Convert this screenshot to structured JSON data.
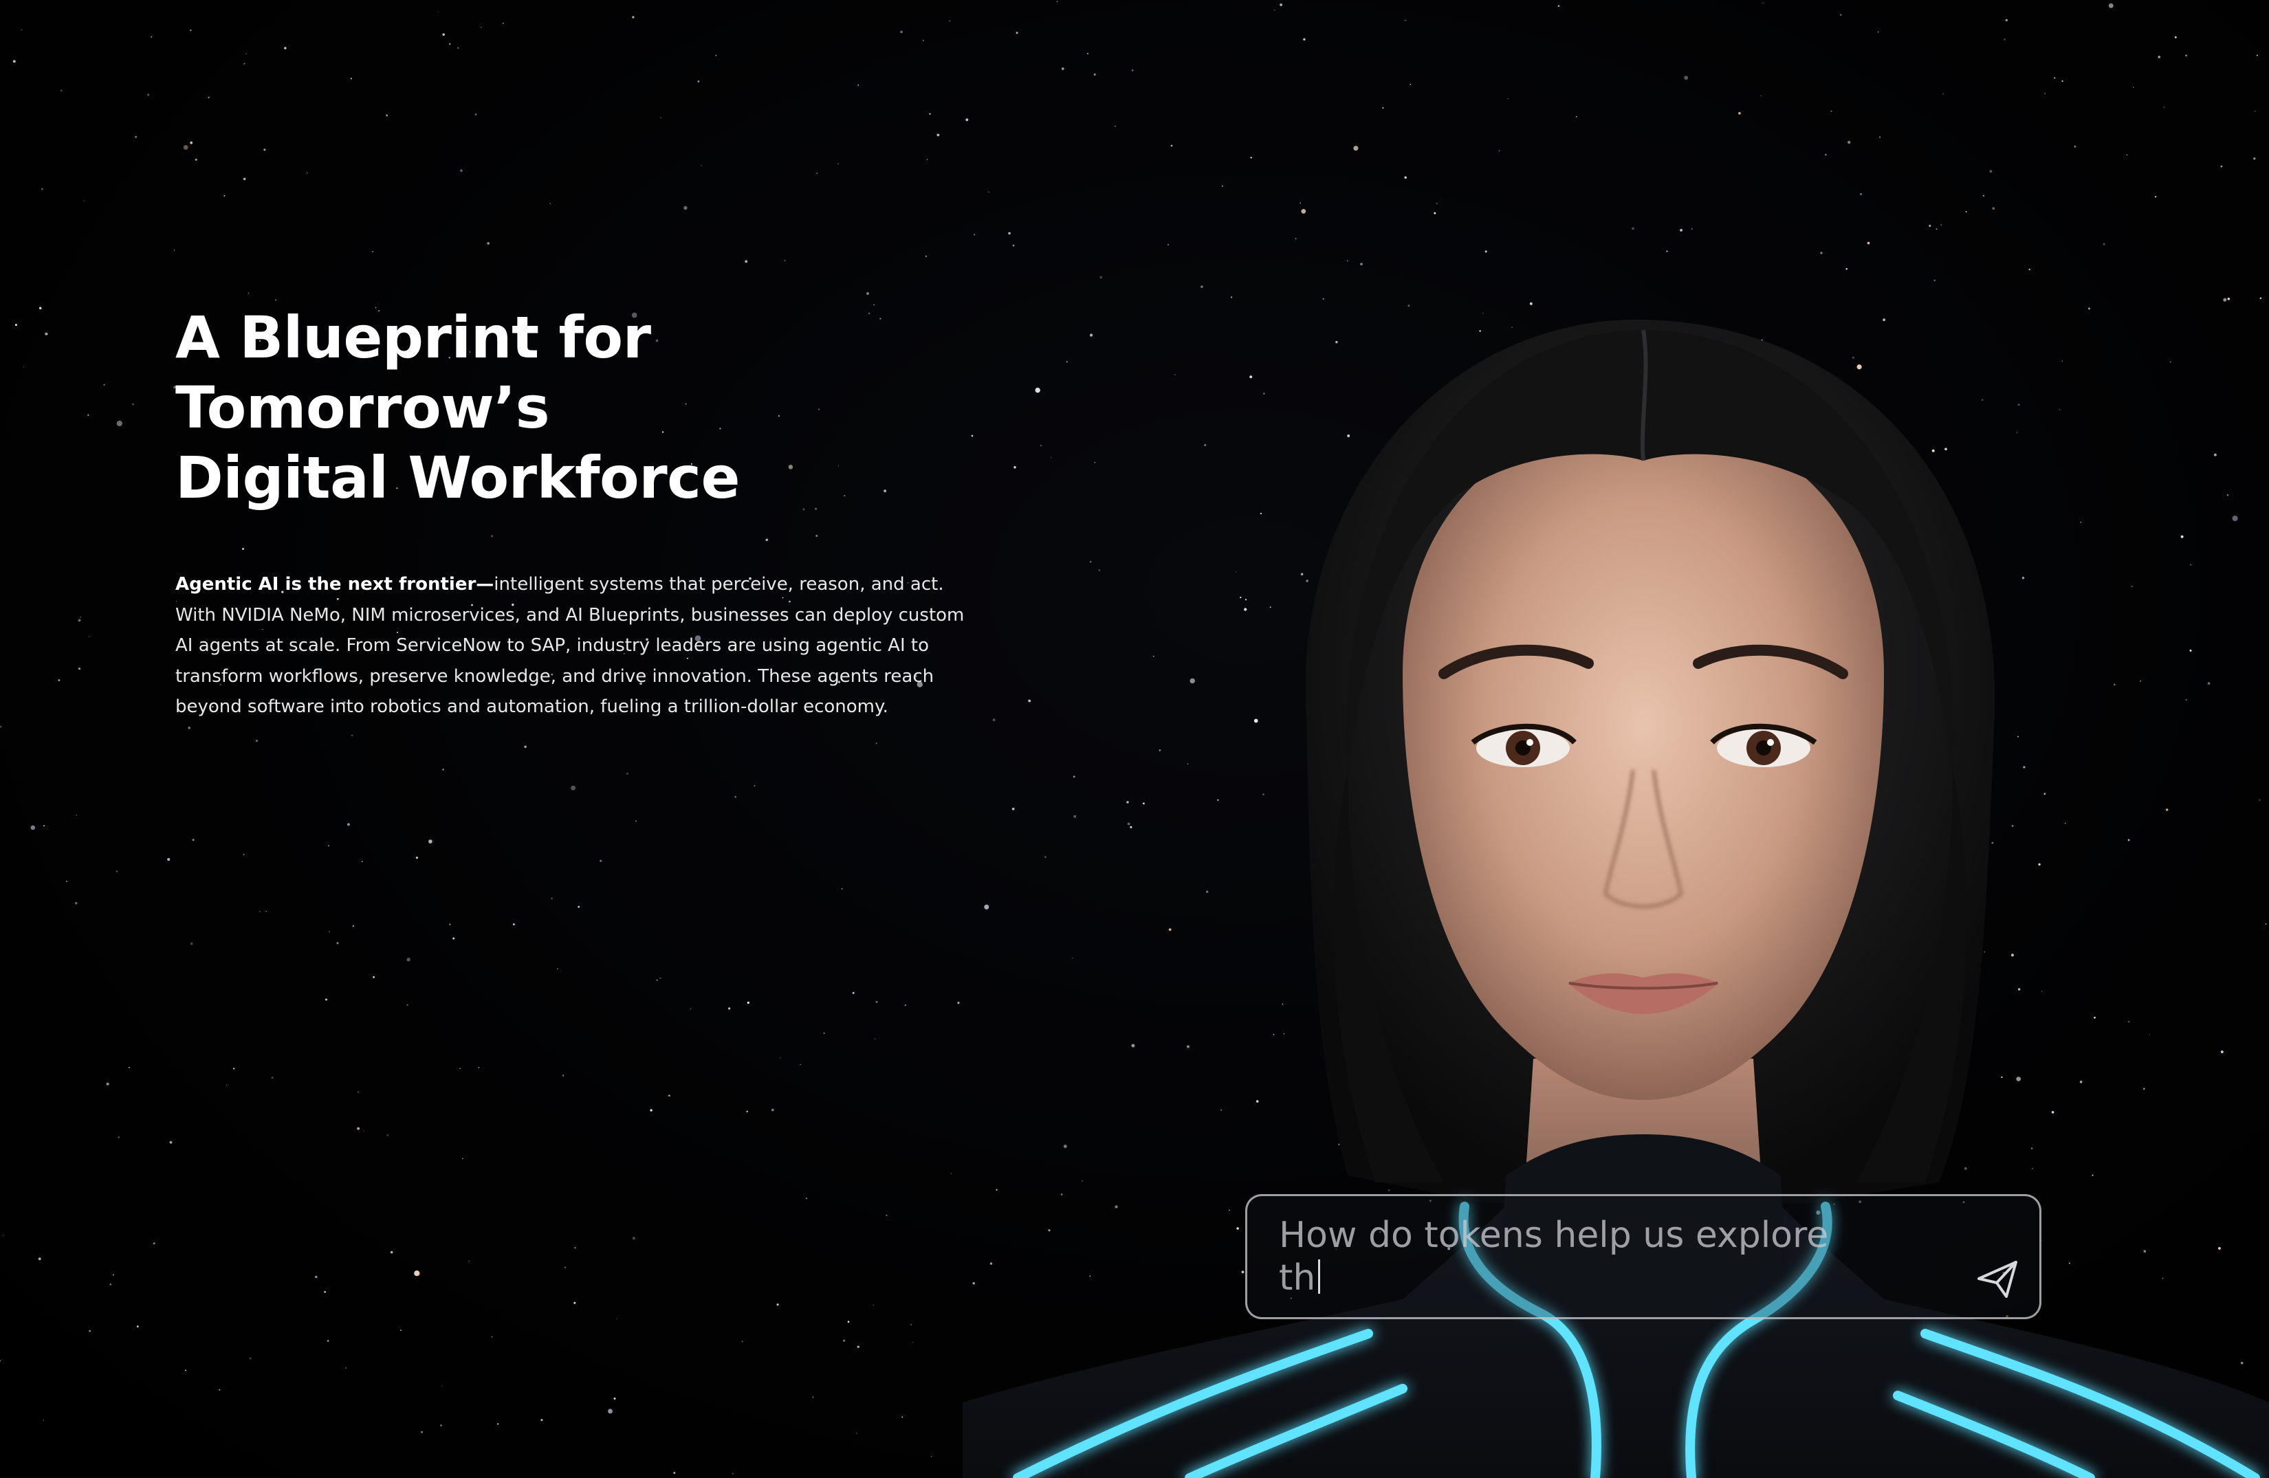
{
  "hero": {
    "headline_line1": "A Blueprint for Tomorrow’s",
    "headline_line2": "Digital Workforce",
    "body_bold": "Agentic AI is the next frontier—",
    "body_rest": "intelligent systems that perceive, reason, and act.",
    "body_line2": "With NVIDIA NeMo, NIM microservices, and AI Blueprints, businesses can deploy custom",
    "body_line3": "AI agents at scale. From ServiceNow to SAP, industry leaders are using agentic AI to",
    "body_line4": "transform workflows, preserve knowledge, and drive innovation. These agents reach",
    "body_line5": "beyond software into robotics and automation, fueling a trillion-dollar economy."
  },
  "chat": {
    "input_line1": "How do tokens help us explore",
    "input_line2": "th",
    "send_icon": "send-icon"
  },
  "colors": {
    "background": "#000000",
    "text": "#ffffff",
    "glow": "#5fe3ff"
  }
}
